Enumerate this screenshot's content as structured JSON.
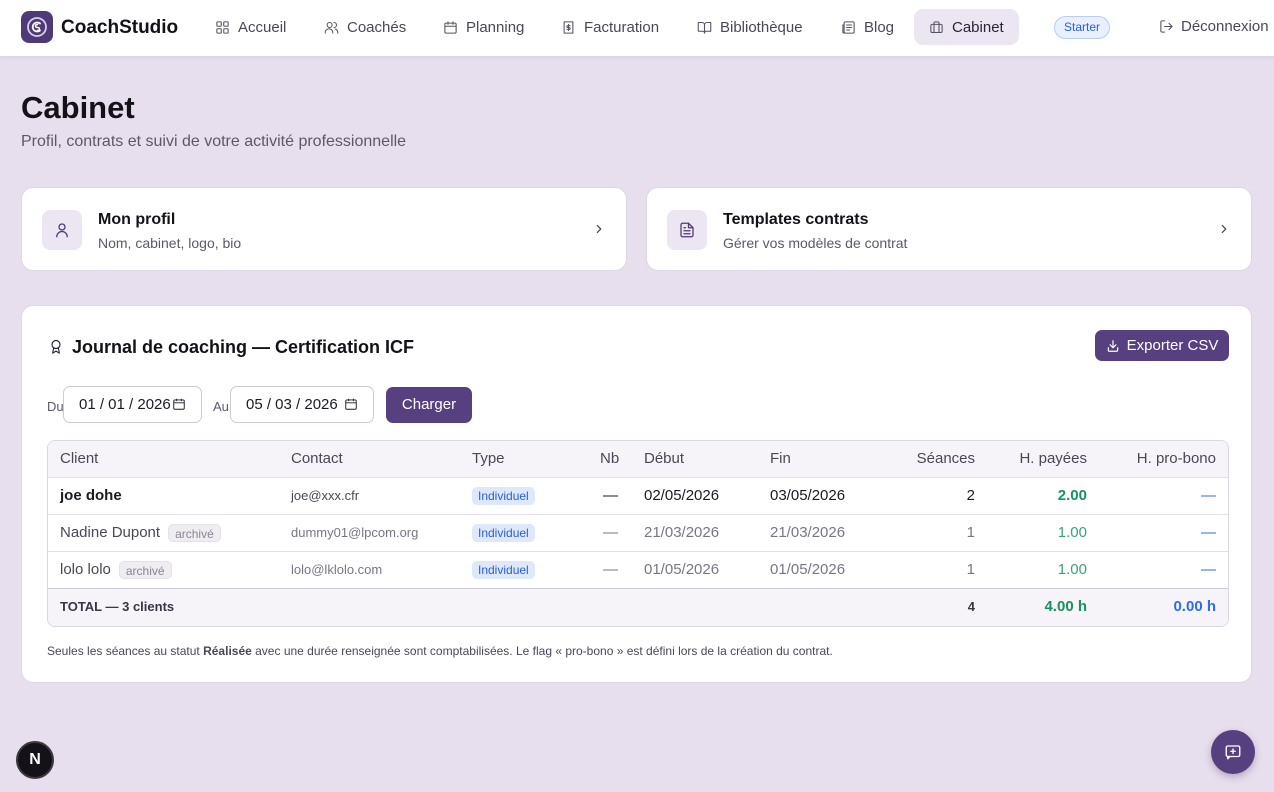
{
  "brand": {
    "name": "CoachStudio"
  },
  "nav": [
    {
      "label": "Accueil",
      "icon": "grid-icon"
    },
    {
      "label": "Coachés",
      "icon": "users-icon"
    },
    {
      "label": "Planning",
      "icon": "calendar-icon"
    },
    {
      "label": "Facturation",
      "icon": "invoice-icon"
    },
    {
      "label": "Bibliothèque",
      "icon": "book-icon"
    },
    {
      "label": "Blog",
      "icon": "newspaper-icon"
    },
    {
      "label": "Cabinet",
      "icon": "briefcase-icon",
      "active": true
    }
  ],
  "plan_badge": "Starter",
  "logout": "Déconnexion",
  "page": {
    "title": "Cabinet",
    "subtitle": "Profil, contrats et suivi de votre activité professionnelle"
  },
  "cards": [
    {
      "title": "Mon profil",
      "subtitle": "Nom, cabinet, logo, bio",
      "icon": "user-icon"
    },
    {
      "title": "Templates contrats",
      "subtitle": "Gérer vos modèles de contrat",
      "icon": "file-text-icon"
    }
  ],
  "journal": {
    "title": "Journal de coaching — Certification ICF",
    "export_label": "Exporter CSV",
    "from_label": "Du",
    "from_value": "01 / 01 / 2026",
    "to_label": "Au",
    "to_value": "05 / 03 / 2026",
    "load_label": "Charger",
    "columns": [
      "Client",
      "Contact",
      "Type",
      "Nb",
      "Début",
      "Fin",
      "Séances",
      "H. payées",
      "H. pro-bono"
    ],
    "rows": [
      {
        "client": "joe dohe",
        "archived": "",
        "contact": "joe@xxx.cfr",
        "type": "Individuel",
        "nb": "—",
        "start": "02/05/2026",
        "end": "03/05/2026",
        "sessions": "2",
        "paid": "2.00",
        "probono": "—"
      },
      {
        "client": "Nadine Dupont",
        "archived": "archivé",
        "contact": "dummy01@lpcom.org",
        "type": "Individuel",
        "nb": "—",
        "start": "21/03/2026",
        "end": "21/03/2026",
        "sessions": "1",
        "paid": "1.00",
        "probono": "—"
      },
      {
        "client": "lolo lolo",
        "archived": "archivé",
        "contact": "lolo@lklolo.com",
        "type": "Individuel",
        "nb": "—",
        "start": "01/05/2026",
        "end": "01/05/2026",
        "sessions": "1",
        "paid": "1.00",
        "probono": "—"
      }
    ],
    "total": {
      "label": "TOTAL — 3 clients",
      "sessions": "4",
      "paid": "4.00 h",
      "probono": "0.00 h"
    },
    "note_before": "Seules les séances au statut ",
    "note_strong": "Réalisée",
    "note_after": " avec une durée renseignée sont comptabilisées. Le flag « pro-bono » est défini lors de la création du contrat."
  },
  "dev_badge": "N",
  "colors": {
    "accent": "#57407f",
    "background": "#e7dfee",
    "paid": "#1a9160",
    "probono": "#2f6ee0"
  }
}
